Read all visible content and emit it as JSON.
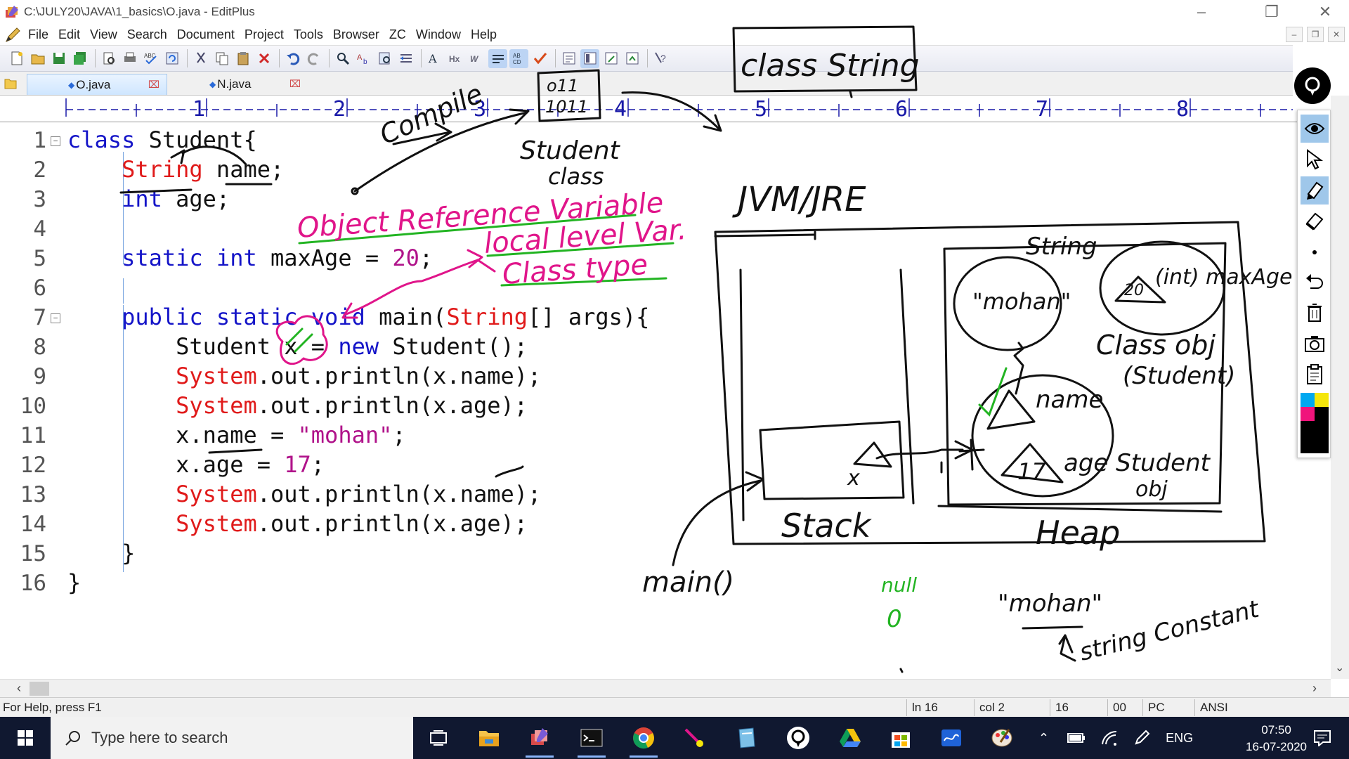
{
  "window": {
    "title": "C:\\JULY20\\JAVA\\1_basics\\O.java - EditPlus"
  },
  "menu": [
    "File",
    "Edit",
    "View",
    "Search",
    "Document",
    "Project",
    "Tools",
    "Browser",
    "ZC",
    "Window",
    "Help"
  ],
  "tabs": [
    {
      "label": "O.java",
      "active": true
    },
    {
      "label": "N.java",
      "active": false
    }
  ],
  "ruler": [
    "1",
    "2",
    "3",
    "4",
    "5",
    "6",
    "7",
    "8"
  ],
  "editor": {
    "line_numbers": [
      "1",
      "2",
      "3",
      "4",
      "5",
      "6",
      "7",
      "8",
      "9",
      "10",
      "11",
      "12",
      "13",
      "14",
      "15",
      "16"
    ],
    "code": {
      "l1_kw": "class",
      "l1_rest": " Student{",
      "l2_type": "String",
      "l2_rest": " name;",
      "l3_kw": "int",
      "l3_rest": " age;",
      "l5_kw1": "static",
      "l5_kw2": "int",
      "l5_mid": " maxAge = ",
      "l5_num": "20",
      "l5_end": ";",
      "l7_kw1": "public",
      "l7_kw2": "static",
      "l7_kw3": "void",
      "l7_mid": " main(",
      "l7_type": "String",
      "l7_end": "[] args){",
      "l8_a": "Student x = ",
      "l8_kw": "new",
      "l8_b": " Student();",
      "l9_sys": "System",
      "l9_rest": ".out.println(x.name);",
      "l10_sys": "System",
      "l10_rest": ".out.println(x.age);",
      "l11_a": "x.name = ",
      "l11_str": "\"mohan\"",
      "l11_end": ";",
      "l12_a": "x.age = ",
      "l12_num": "17",
      "l12_end": ";",
      "l13_sys": "System",
      "l13_rest": ".out.println(x.name);",
      "l14_sys": "System",
      "l14_rest": ".out.println(x.age);",
      "l15": "}",
      "l16": "}"
    }
  },
  "status": {
    "help": "For Help, press F1",
    "ln": "ln 16",
    "col": "col 2",
    "count": "16",
    "code": "00",
    "mode": "PC",
    "encoding": "ANSI"
  },
  "taskbar": {
    "search_placeholder": "Type here to search",
    "lang": "ENG",
    "time": "07:50",
    "date": "16-07-2020"
  },
  "annotations": {
    "compile": "Compile",
    "bytecode_top": "o11",
    "bytecode_bottom": "1011",
    "student_class_1": "Student",
    "student_class_2": "class",
    "class_string": "class String",
    "obj_ref_var": "Object Reference Variable",
    "local_level_var": "local level Var.",
    "class_type": "Class type",
    "jvm_jre": "JVM/JRE",
    "string_label": "String",
    "mohan_obj": "\"mohan\"",
    "int_maxage": "(int) maxAge",
    "maxage_value": "20",
    "class_obj_1": "Class obj",
    "class_obj_2": "(Student)",
    "name_field": "name",
    "age_value": "17",
    "student_obj_1": "age Student",
    "student_obj_2": "obj",
    "stack_var": "x",
    "stack": "Stack",
    "heap": "Heap",
    "main_label": "main()",
    "null_label": "null",
    "zero_label": "0",
    "mohan_const": "\"mohan\"",
    "string_constant": "string Constant"
  },
  "colors": {
    "keyword": "#1515c8",
    "type": "#e01a1a",
    "literal": "#b0138a",
    "ink_black": "#111111",
    "ink_magenta": "#e0158a",
    "ink_green": "#22b422"
  }
}
